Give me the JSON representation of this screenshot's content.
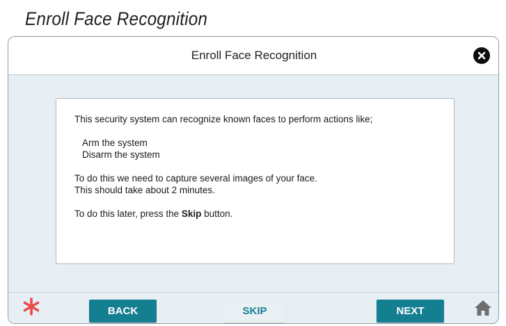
{
  "page": {
    "heading": "Enroll Face Recognition"
  },
  "dialog": {
    "title": "Enroll Face Recognition",
    "close_icon": "close-circle-icon",
    "body": {
      "intro": "This security system can recognize known faces to perform actions like;",
      "actions": [
        "Arm the system",
        "Disarm the system"
      ],
      "capture_line1": "To do this we need to capture several images of your face.",
      "capture_line2": "This should take about 2 minutes.",
      "later_prefix": "To do this later, press the ",
      "later_bold": "Skip",
      "later_suffix": " button."
    }
  },
  "footer": {
    "emergency_icon": "asterisk-icon",
    "back_label": "BACK",
    "skip_label": "SKIP",
    "next_label": "NEXT",
    "home_icon": "home-icon"
  },
  "colors": {
    "accent": "#157f92",
    "emergency": "#e84a4a",
    "background": "#e7eff5"
  }
}
